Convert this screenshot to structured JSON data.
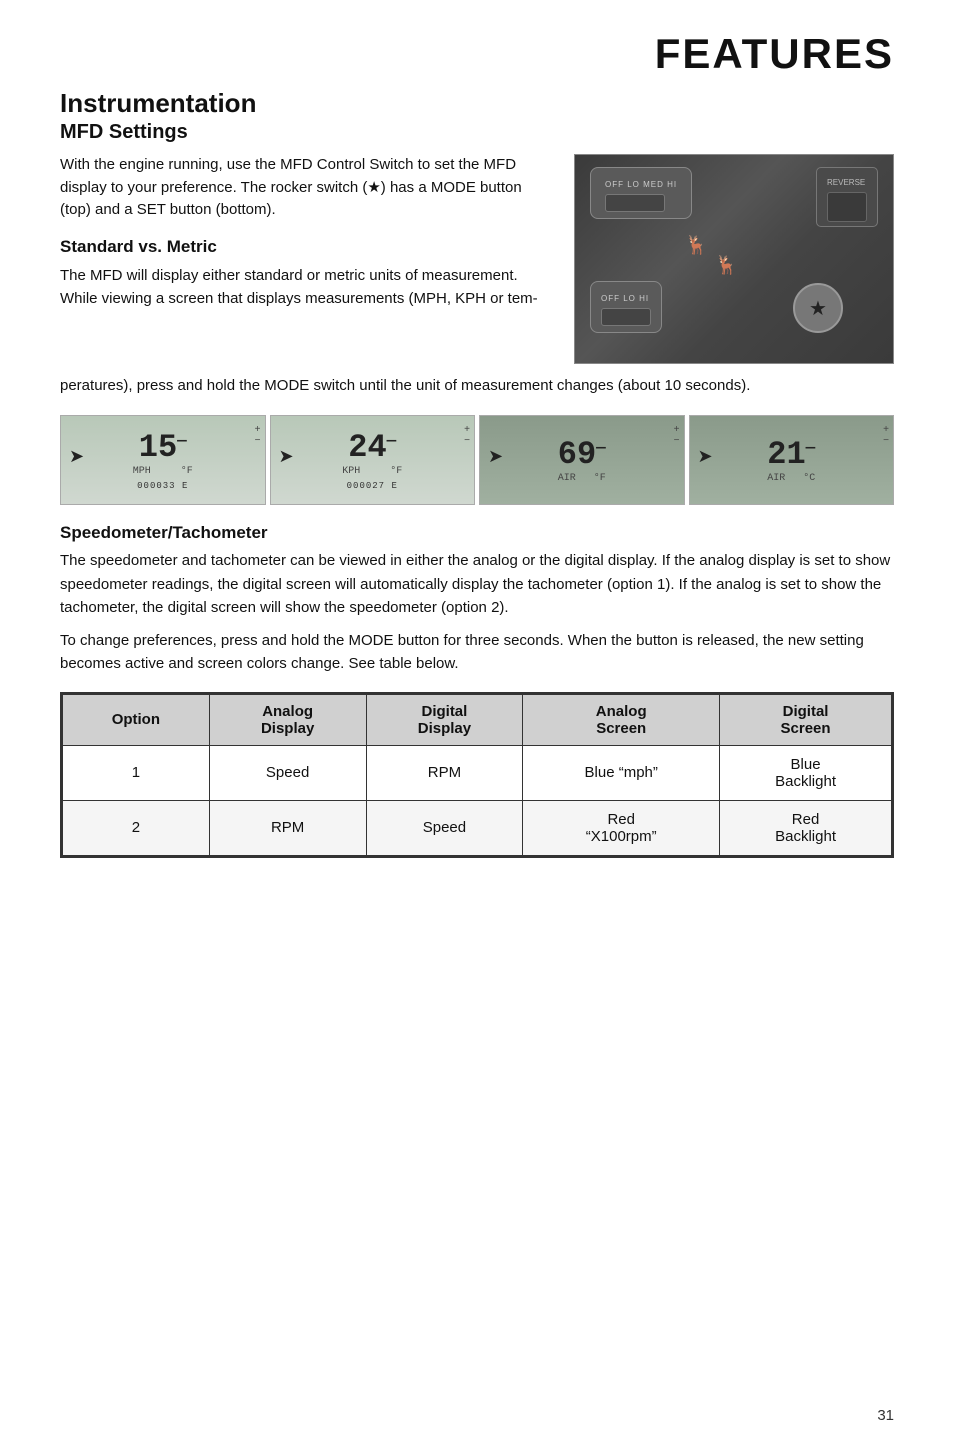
{
  "page": {
    "title": "FEATURES",
    "page_number": "31"
  },
  "section": {
    "main_title": "Instrumentation",
    "sub_title": "MFD Settings",
    "intro_paragraph": "With the engine running, use the MFD Control Switch to set the MFD display to your preference. The rocker switch (★) has a MODE button (top) and a SET button (bottom).",
    "standard_metric_heading": "Standard vs. Metric",
    "standard_metric_text": "The MFD will display either standard or metric units of measurement. While viewing a screen that displays measurements (MPH, KPH or temperatures), press and hold the MODE switch until the unit of measurement changes (about 10 seconds).",
    "speedo_tacho_heading": "Speedometer/Tachometer",
    "speedo_tacho_text1": "The speedometer and tachometer can be viewed in either the analog or the digital display. If the analog display is set to show speedometer readings, the digital screen will automatically display the tachometer (option 1). If the analog is set to show the tachometer, the digital screen will show the speedometer (option 2).",
    "speedo_tacho_text2": "To change preferences, press and hold the MODE button for three seconds. When the button is released, the new setting becomes active and screen colors change. See table below."
  },
  "display_images": [
    {
      "number": "15",
      "unit": "MPH",
      "odo": "000033",
      "dark": false
    },
    {
      "number": "24",
      "unit": "KPH",
      "odo": "000027",
      "dark": false
    },
    {
      "number": "69",
      "unit": "AIR °F",
      "odo": "",
      "dark": true
    },
    {
      "number": "21",
      "unit": "AIR °C",
      "odo": "",
      "dark": true
    }
  ],
  "table": {
    "headers": [
      "Option",
      "Analog\nDisplay",
      "Digital\nDisplay",
      "Analog\nScreen",
      "Digital\nScreen"
    ],
    "rows": [
      {
        "option": "1",
        "analog_display": "Speed",
        "digital_display": "RPM",
        "analog_screen": "Blue \"mph\"",
        "digital_screen": "Blue\nBacklight"
      },
      {
        "option": "2",
        "analog_display": "RPM",
        "digital_display": "Speed",
        "analog_screen": "Red\n\"X100rpm\"",
        "digital_screen": "Red\nBacklight"
      }
    ]
  },
  "mfd_panel": {
    "label_top": "OFF LO MED HI",
    "label_reverse": "REVERSE",
    "label_bottom": "OFF LO HI",
    "star_symbol": "★"
  }
}
